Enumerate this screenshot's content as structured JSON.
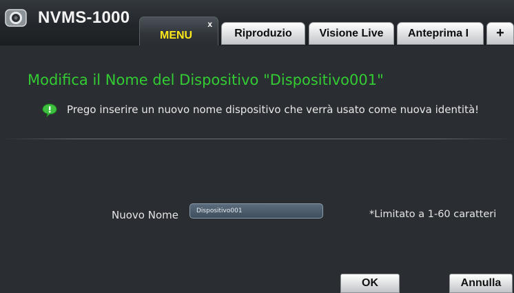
{
  "app": {
    "title": "NVMS-1000",
    "logo_icon": "webcam-icon"
  },
  "tabs": [
    {
      "label": "MENU",
      "active": true,
      "close_label": "x"
    },
    {
      "label": "Riproduzio",
      "active": false
    },
    {
      "label": "Visione Live",
      "active": false
    },
    {
      "label": "Anteprima I",
      "active": false
    }
  ],
  "add_tab_label": "+",
  "dialog": {
    "heading": "Modifica il Nome del Dispositivo \"Dispositivo001\"",
    "tip_icon": "speech-bubble-icon",
    "tip": "Prego inserire un nuovo nome dispositivo che verrà usato come nuova identità!",
    "field_label": "Nuovo Nome",
    "field_value": "Dispositivo001",
    "limit_note": "*Limitato a 1-60 caratteri",
    "ok_label": "OK",
    "cancel_label": "Annulla"
  },
  "colors": {
    "heading": "#33cc33",
    "active_tab_text": "#ffe81a",
    "background": "#2a2d31"
  }
}
